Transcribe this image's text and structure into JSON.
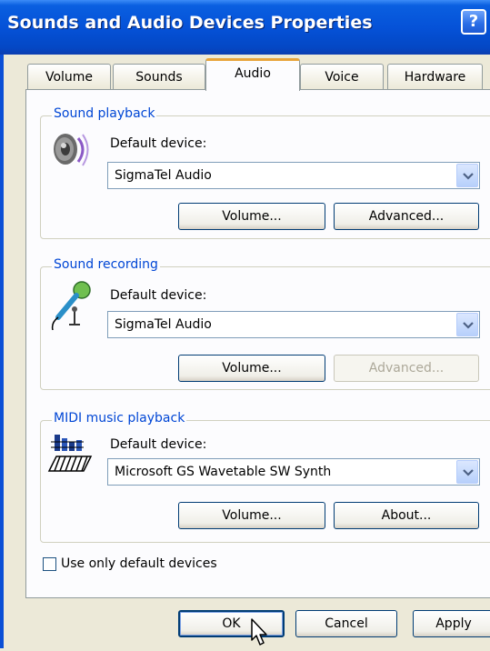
{
  "window": {
    "title": "Sounds and Audio Devices Properties",
    "help_label": "?"
  },
  "tabs": [
    {
      "label": "Volume"
    },
    {
      "label": "Sounds"
    },
    {
      "label": "Audio",
      "active": true
    },
    {
      "label": "Voice"
    },
    {
      "label": "Hardware"
    }
  ],
  "sound_playback": {
    "legend": "Sound playback",
    "device_label": "Default device:",
    "device_value": "SigmaTel Audio",
    "icon": "speaker-icon",
    "volume_button": "Volume...",
    "advanced_button": "Advanced..."
  },
  "sound_recording": {
    "legend": "Sound recording",
    "device_label": "Default device:",
    "device_value": "SigmaTel Audio",
    "icon": "microphone-icon",
    "volume_button": "Volume...",
    "advanced_button": "Advanced...",
    "advanced_enabled": false
  },
  "midi_playback": {
    "legend": "MIDI music playback",
    "device_label": "Default device:",
    "device_value": "Microsoft GS Wavetable SW Synth",
    "icon": "midi-keyboard-icon",
    "volume_button": "Volume...",
    "about_button": "About..."
  },
  "options": {
    "use_default_only_label": "Use only default devices",
    "use_default_only_checked": false
  },
  "footer": {
    "ok_label": "OK",
    "cancel_label": "Cancel",
    "apply_label": "Apply"
  },
  "colors": {
    "titlebar": "#0552d8",
    "legend_text": "#0046d5",
    "active_tab_accent": "#e8a43a",
    "window_bg": "#ece9d8"
  }
}
